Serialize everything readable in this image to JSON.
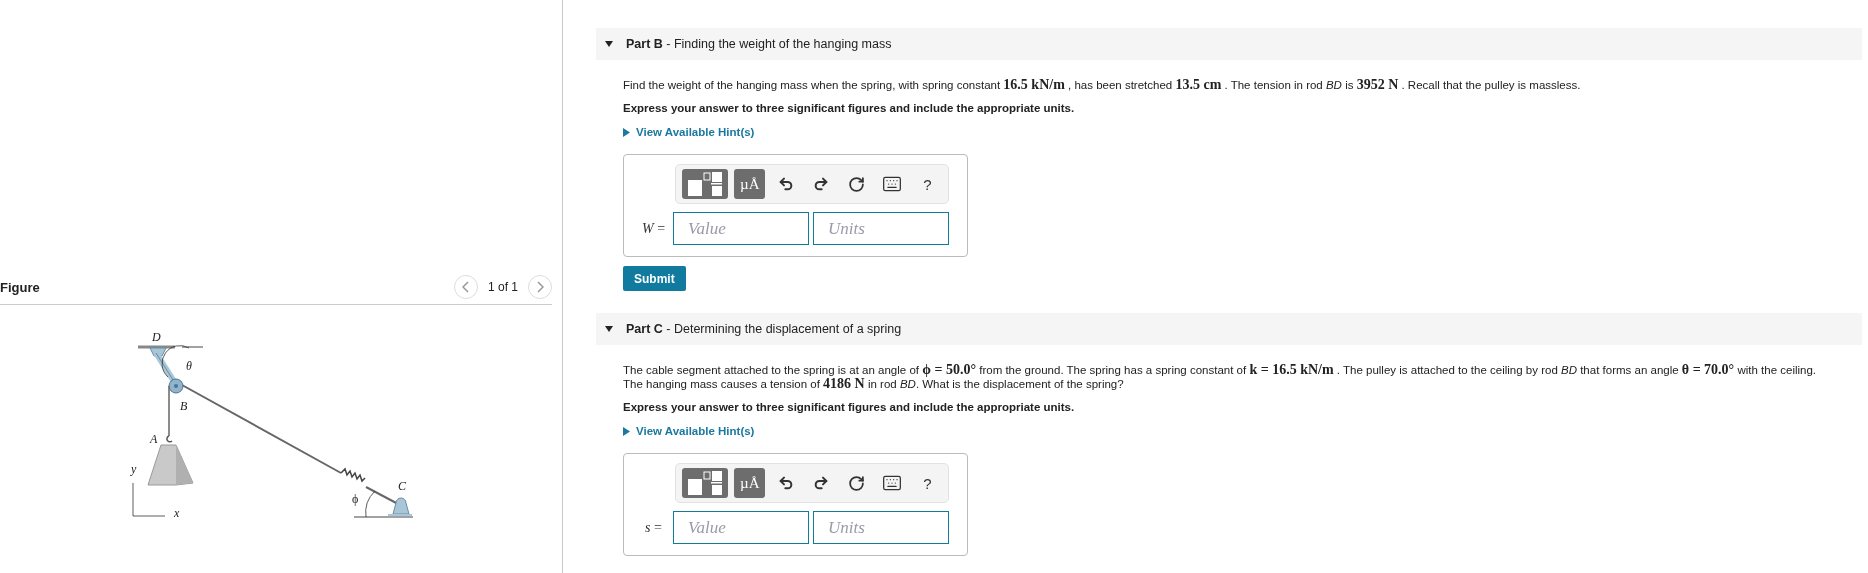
{
  "figure_panel": {
    "title": "Figure",
    "pager": "1 of 1",
    "labels": [
      {
        "text": "D"
      },
      {
        "text": "θ"
      },
      {
        "text": "B"
      },
      {
        "text": "A"
      },
      {
        "text": "y"
      },
      {
        "text": "x"
      },
      {
        "text": "C"
      },
      {
        "text": "ϕ"
      }
    ]
  },
  "parts": [
    {
      "title_bold": "Part B",
      "title_rest": " - Finding the weight of the hanging mass",
      "expanded": true,
      "problem": [
        {
          "kind": "text",
          "text": "Find the weight of the hanging mass when the spring, with spring constant "
        },
        {
          "kind": "math",
          "text": "16.5 kN/m"
        },
        {
          "kind": "text",
          "text": " , has been stretched "
        },
        {
          "kind": "math",
          "text": "13.5 cm"
        },
        {
          "kind": "text",
          "text": " . The tension in rod "
        },
        {
          "kind": "italic",
          "text": "BD"
        },
        {
          "kind": "text",
          "text": " is "
        },
        {
          "kind": "math",
          "text": "3952 N"
        },
        {
          "kind": "text",
          "text": " . Recall that the pulley is massless."
        }
      ],
      "instruction": "Express your answer to three significant figures and include the appropriate units.",
      "hint_link": "View Available Hint(s)",
      "toolbar": {
        "units_button": "µÅ",
        "help": "?"
      },
      "answer": {
        "label": "*W* =",
        "value_placeholder": "Value",
        "units_placeholder": "Units"
      },
      "submit": "Submit"
    },
    {
      "title_bold": "Part C",
      "title_rest": " - Determining the displacement of a spring",
      "expanded": true,
      "problem": [
        {
          "kind": "text",
          "text": "The cable segment attached to the spring is at an angle of "
        },
        {
          "kind": "math",
          "text": "ϕ = 50.0°"
        },
        {
          "kind": "text",
          "text": " from the ground. The spring has a spring constant of "
        },
        {
          "kind": "math",
          "text": "k = 16.5 kN/m"
        },
        {
          "kind": "text",
          "text": " . The pulley is attached to the ceiling by rod "
        },
        {
          "kind": "italic",
          "text": "BD"
        },
        {
          "kind": "text",
          "text": " that forms an angle "
        },
        {
          "kind": "math",
          "text": "θ = 70.0°"
        },
        {
          "kind": "text",
          "text": " with the ceiling. The hanging mass causes a tension of "
        },
        {
          "kind": "math",
          "text": "4186 N"
        },
        {
          "kind": "text",
          "text": " in rod  "
        },
        {
          "kind": "italic",
          "text": "BD"
        },
        {
          "kind": "text",
          "text": ". What is the displacement of the spring?"
        }
      ],
      "instruction": "Express your answer to three significant figures and include the appropriate units.",
      "hint_link": "View Available Hint(s)",
      "toolbar": {
        "units_button": "µÅ",
        "help": "?"
      },
      "answer": {
        "label": "*s* =",
        "value_placeholder": "Value",
        "units_placeholder": "Units"
      }
    }
  ]
}
